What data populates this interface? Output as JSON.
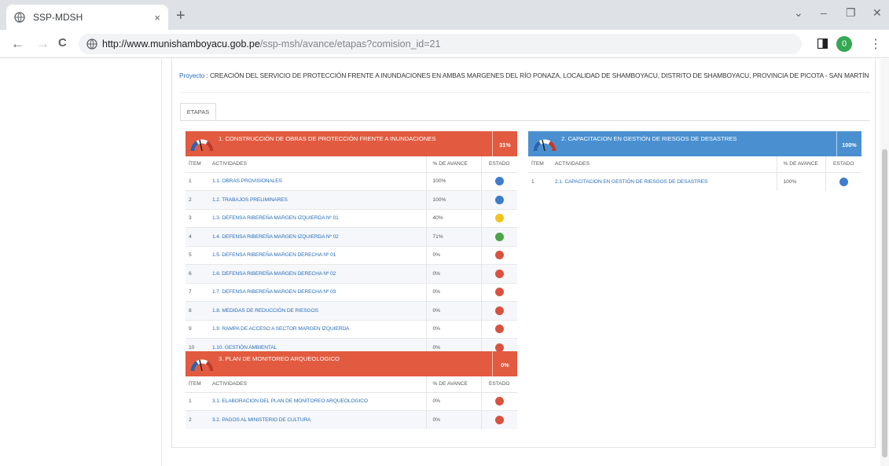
{
  "browser": {
    "tab_title": "SSP-MDSH",
    "tab_close": "×",
    "new_tab": "+",
    "url_host": "http://www.munishamboyacu.gob.pe",
    "url_rest": "/ssp-msh/avance/etapas?comision_id=21",
    "profile_letter": "0",
    "minimize": "–",
    "restore": "❐",
    "close": "✕",
    "dropdown": "⌄",
    "back": "←",
    "forward": "→",
    "reload": "C",
    "menu": "⋮"
  },
  "project": {
    "label": "Proyecto",
    "separator": " : ",
    "name": "CREACIÓN DEL SERVICIO DE PROTECCIÓN FRENTE A INUNDACIONES EN AMBAS MARGENES DEL RÍO PONAZA, LOCALIDAD DE SHAMBOYACU, DISTRITO DE SHAMBOYACU, PROVINCIA DE PICOTA - SAN MARTÍN"
  },
  "tabs": {
    "etapas": "ETAPAS"
  },
  "columns": {
    "item": "ÍTEM",
    "actividades": "ACTIVIDADES",
    "avance": "% DE AVANCE",
    "estado": "ESTADO"
  },
  "stage1": {
    "title": "1. CONSTRUCCIÓN DE OBRAS DE PROTECCIÓN FRENTE A INUNDACIONES",
    "percent": "31%",
    "rows": [
      {
        "item": "1",
        "actividad": "1.1. OBRAS PROVISIONALES",
        "avance": "100%",
        "estado": "blue"
      },
      {
        "item": "2",
        "actividad": "1.2. TRABAJOS PRELIMINARES",
        "avance": "100%",
        "estado": "blue"
      },
      {
        "item": "3",
        "actividad": "1.3. DEFENSA RIBEREÑA MARGEN IZQUIERDA Nº 01",
        "avance": "40%",
        "estado": "yellow"
      },
      {
        "item": "4",
        "actividad": "1.4. DEFENSA RIBEREÑA MARGEN IZQUIERDA Nº 02",
        "avance": "71%",
        "estado": "green"
      },
      {
        "item": "5",
        "actividad": "1.5. DEFENSA RIBEREÑA MARGEN DERECHA Nº 01",
        "avance": "0%",
        "estado": "red"
      },
      {
        "item": "6",
        "actividad": "1.6. DEFENSA RIBEREÑA MARGEN DERECHA Nº 02",
        "avance": "0%",
        "estado": "red"
      },
      {
        "item": "7",
        "actividad": "1.7. DEFENSA RIBEREÑA MARGEN DERECHA Nº 03",
        "avance": "0%",
        "estado": "red"
      },
      {
        "item": "8",
        "actividad": "1.8. MEDIDAS DE REDUCCIÓN DE RIESGOS",
        "avance": "0%",
        "estado": "red"
      },
      {
        "item": "9",
        "actividad": "1.9. RAMPA DE ACCESO A SECTOR MARGEN IZQUIERDA",
        "avance": "0%",
        "estado": "red"
      },
      {
        "item": "10",
        "actividad": "1.10. GESTIÓN AMBIENTAL",
        "avance": "0%",
        "estado": "red"
      }
    ]
  },
  "stage2": {
    "title": "2. CAPACITACION EN GESTIÓN DE RIESGOS DE DESASTRES",
    "percent": "100%",
    "rows": [
      {
        "item": "1",
        "actividad": "2.1. CAPACITACION EN GESTIÓN DE RIESGOS DE DESASTRES",
        "avance": "100%",
        "estado": "blue"
      }
    ]
  },
  "stage3": {
    "title": "3. PLAN DE MONITOREO ARQUEOLOGICO",
    "percent": "0%",
    "rows": [
      {
        "item": "1",
        "actividad": "3.1. ELABORACION DEL PLAN DE MONITOREO ARQUEOLOGICO",
        "avance": "0%",
        "estado": "red"
      },
      {
        "item": "2",
        "actividad": "3.2. PAGOS AL MINISTERIO DE CULTURA",
        "avance": "0%",
        "estado": "red"
      }
    ]
  }
}
